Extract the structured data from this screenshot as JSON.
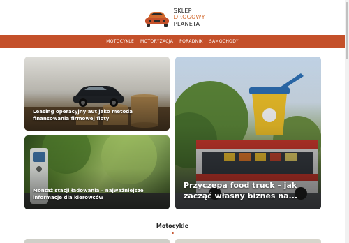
{
  "logo": {
    "line1": "SKLEP",
    "line2": "DROGOWY",
    "line3": "PLANETA",
    "icon": "car-logo-icon"
  },
  "nav": {
    "items": [
      {
        "label": "MOTOCYKLE"
      },
      {
        "label": "MOTORYZACJA"
      },
      {
        "label": "PORADNIK"
      },
      {
        "label": "SAMOCHODY"
      }
    ]
  },
  "featured": [
    {
      "title": "Leasing operacyjny aut jako metoda finansowania firmowej floty",
      "image": "car-on-coins-image"
    },
    {
      "title": "Montaż stacji ładowania – najważniejsze informacje dla kierowców",
      "image": "charging-station-image"
    },
    {
      "title": "Przyczepa food truck – jak zacząć własny biznes na...",
      "image": "food-truck-image"
    }
  ],
  "section": {
    "title": "Motocykle"
  },
  "colors": {
    "accent": "#c4502a",
    "logo_accent": "#d2692d"
  }
}
